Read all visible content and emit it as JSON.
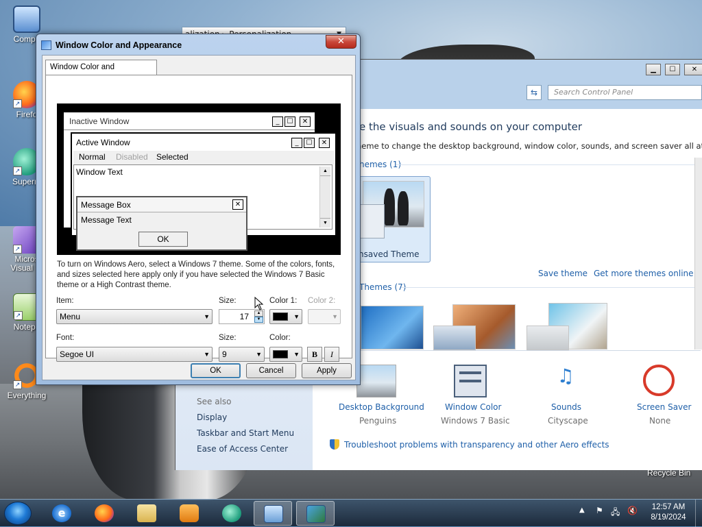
{
  "desktop": {
    "icons": [
      {
        "label": "Compu",
        "name": "computer"
      },
      {
        "label": "Firefo",
        "name": "firefox"
      },
      {
        "label": "Superm",
        "name": "supermium"
      },
      {
        "label": "Micros Visual St",
        "name": "visual-studio"
      },
      {
        "label": "Notepa",
        "name": "notepad"
      },
      {
        "label": "Everything",
        "name": "everything"
      }
    ],
    "recycle_bin": "Recycle Bin"
  },
  "control_panel": {
    "breadcrumb": "alization",
    "breadcrumb_current": "Personalization",
    "search_placeholder": "Search Control Panel",
    "heading": "e the visuals and sounds on your computer",
    "subheading": "heme to change the desktop background, window color, sounds, and screen saver all at once.",
    "my_themes": "hemes (1)",
    "unsaved_theme": "nsaved Theme",
    "save_theme": "Save theme",
    "get_more": "Get more themes online",
    "aero_themes": "Themes (7)",
    "see_also": "See also",
    "left_links": [
      "Display",
      "Taskbar and Start Menu",
      "Ease of Access Center"
    ],
    "bottom": [
      {
        "title": "Desktop Background",
        "sub": "Penguins"
      },
      {
        "title": "Window Color",
        "sub": "Windows 7 Basic"
      },
      {
        "title": "Sounds",
        "sub": "Cityscape"
      },
      {
        "title": "Screen Saver",
        "sub": "None"
      }
    ],
    "troubleshoot": "Troubleshoot problems with transparency and other Aero effects"
  },
  "dialog": {
    "title": "Window Color and Appearance",
    "close": "✕",
    "tab": "Window Color and Appearance",
    "preview": {
      "inactive": "Inactive Window",
      "active": "Active Window",
      "menu_normal": "Normal",
      "menu_disabled": "Disabled",
      "menu_selected": "Selected",
      "window_text": "Window Text",
      "message_box": "Message Box",
      "message_text": "Message Text",
      "ok": "OK"
    },
    "info": "To turn on Windows Aero, select a Windows 7 theme.  Some of the colors, fonts, and sizes selected here apply only if you have selected the Windows 7 Basic theme or a High Contrast theme.",
    "item_label": "Item:",
    "item_value": "Menu",
    "size_label": "Size:",
    "size_value": "17",
    "color1_label": "Color 1:",
    "color2_label": "Color 2:",
    "font_label": "Font:",
    "font_value": "Segoe UI",
    "font_size_label": "Size:",
    "font_size_value": "9",
    "font_color_label": "Color:",
    "bold": "B",
    "italic": "I",
    "ok": "OK",
    "cancel": "Cancel",
    "apply": "Apply"
  },
  "taskbar": {
    "time": "12:57 AM",
    "date": "8/19/2024"
  },
  "colors": {
    "link": "#1e5fa8",
    "accent": "#3c7fb1",
    "close_red": "#c9473a"
  }
}
